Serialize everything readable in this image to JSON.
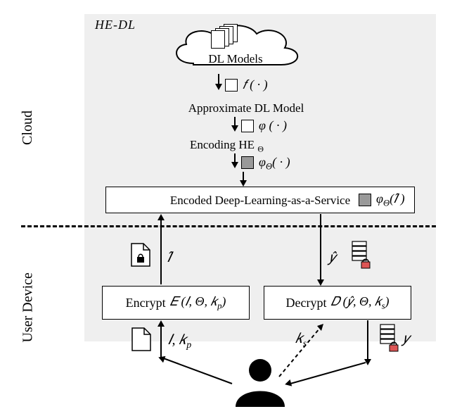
{
  "title": "HE-DL",
  "sections": {
    "cloud_label": "Cloud",
    "user_label": "User Device"
  },
  "cloud_box": {
    "dl_models": "DL Models",
    "f_symbol": "𝑓 ( · )",
    "approx": "Approximate DL Model",
    "phi_symbol": "φ ( · )",
    "encoding": "Encoding HE",
    "encoding_sub": "Θ",
    "phi_theta": "φ",
    "phi_theta_sub": "Θ",
    "phi_theta_arg": "( · )"
  },
  "service": {
    "box_text": "Encoded Deep-Learning-as-a-Service",
    "phi_I": "φ",
    "phi_I_sub": "Θ",
    "phi_I_arg": "(𝐼̂ )"
  },
  "flows": {
    "I_hat": "𝐼̂",
    "y_hat": "𝑦̂",
    "I_kp": "𝐼, 𝑘",
    "I_kp_sub": "p",
    "ks": "𝑘",
    "ks_sub": "s",
    "y": "𝑦"
  },
  "encrypt": {
    "label": "Encrypt",
    "expr": "𝐸 (𝐼, Θ, 𝑘",
    "sub": "p",
    "close": ")"
  },
  "decrypt": {
    "label": "Decrypt",
    "expr": "𝐷 (𝑦̂, Θ, 𝑘",
    "sub": "s",
    "close": ")"
  },
  "icons": {
    "doc": "document-icon",
    "locked_doc": "locked-document-icon",
    "bars": "bars-icon",
    "locked_bars": "locked-bars-icon",
    "user": "user-silhouette-icon"
  }
}
